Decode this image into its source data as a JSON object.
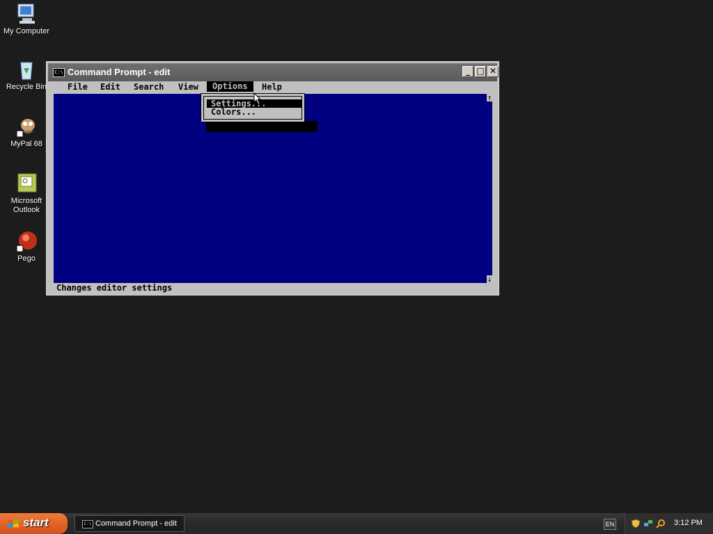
{
  "desktop": {
    "icons": [
      {
        "label": "My Computer",
        "icon": "my-computer-icon"
      },
      {
        "label": "Recycle Bin",
        "icon": "recycle-bin-icon"
      },
      {
        "label": "MyPal 68",
        "icon": "mypal-icon"
      },
      {
        "label": "Microsoft Outlook",
        "icon": "outlook-icon"
      },
      {
        "label": "Pego",
        "icon": "pego-icon"
      }
    ]
  },
  "window": {
    "title": "Command Prompt - edit",
    "app_icon_text": "C:\\",
    "minimize_glyph": "_",
    "maximize_glyph": "□",
    "close_glyph": "✕"
  },
  "editor": {
    "menu": [
      "File",
      "Edit",
      "Search",
      "View",
      "Options",
      "Help"
    ],
    "active_menu": "Options",
    "dropdown": {
      "items": [
        {
          "label": "Settings...",
          "selected": true
        },
        {
          "label": "Colors...",
          "selected": false
        }
      ]
    },
    "scroll_up_glyph": "↑",
    "scroll_down_glyph": "↓",
    "status": "Changes editor settings",
    "background_color": "#000080"
  },
  "taskbar": {
    "start_label": "start",
    "task_item": "Command Prompt - edit",
    "task_icon_text": "C:\\",
    "language": "EN",
    "clock": "3:12 PM"
  }
}
